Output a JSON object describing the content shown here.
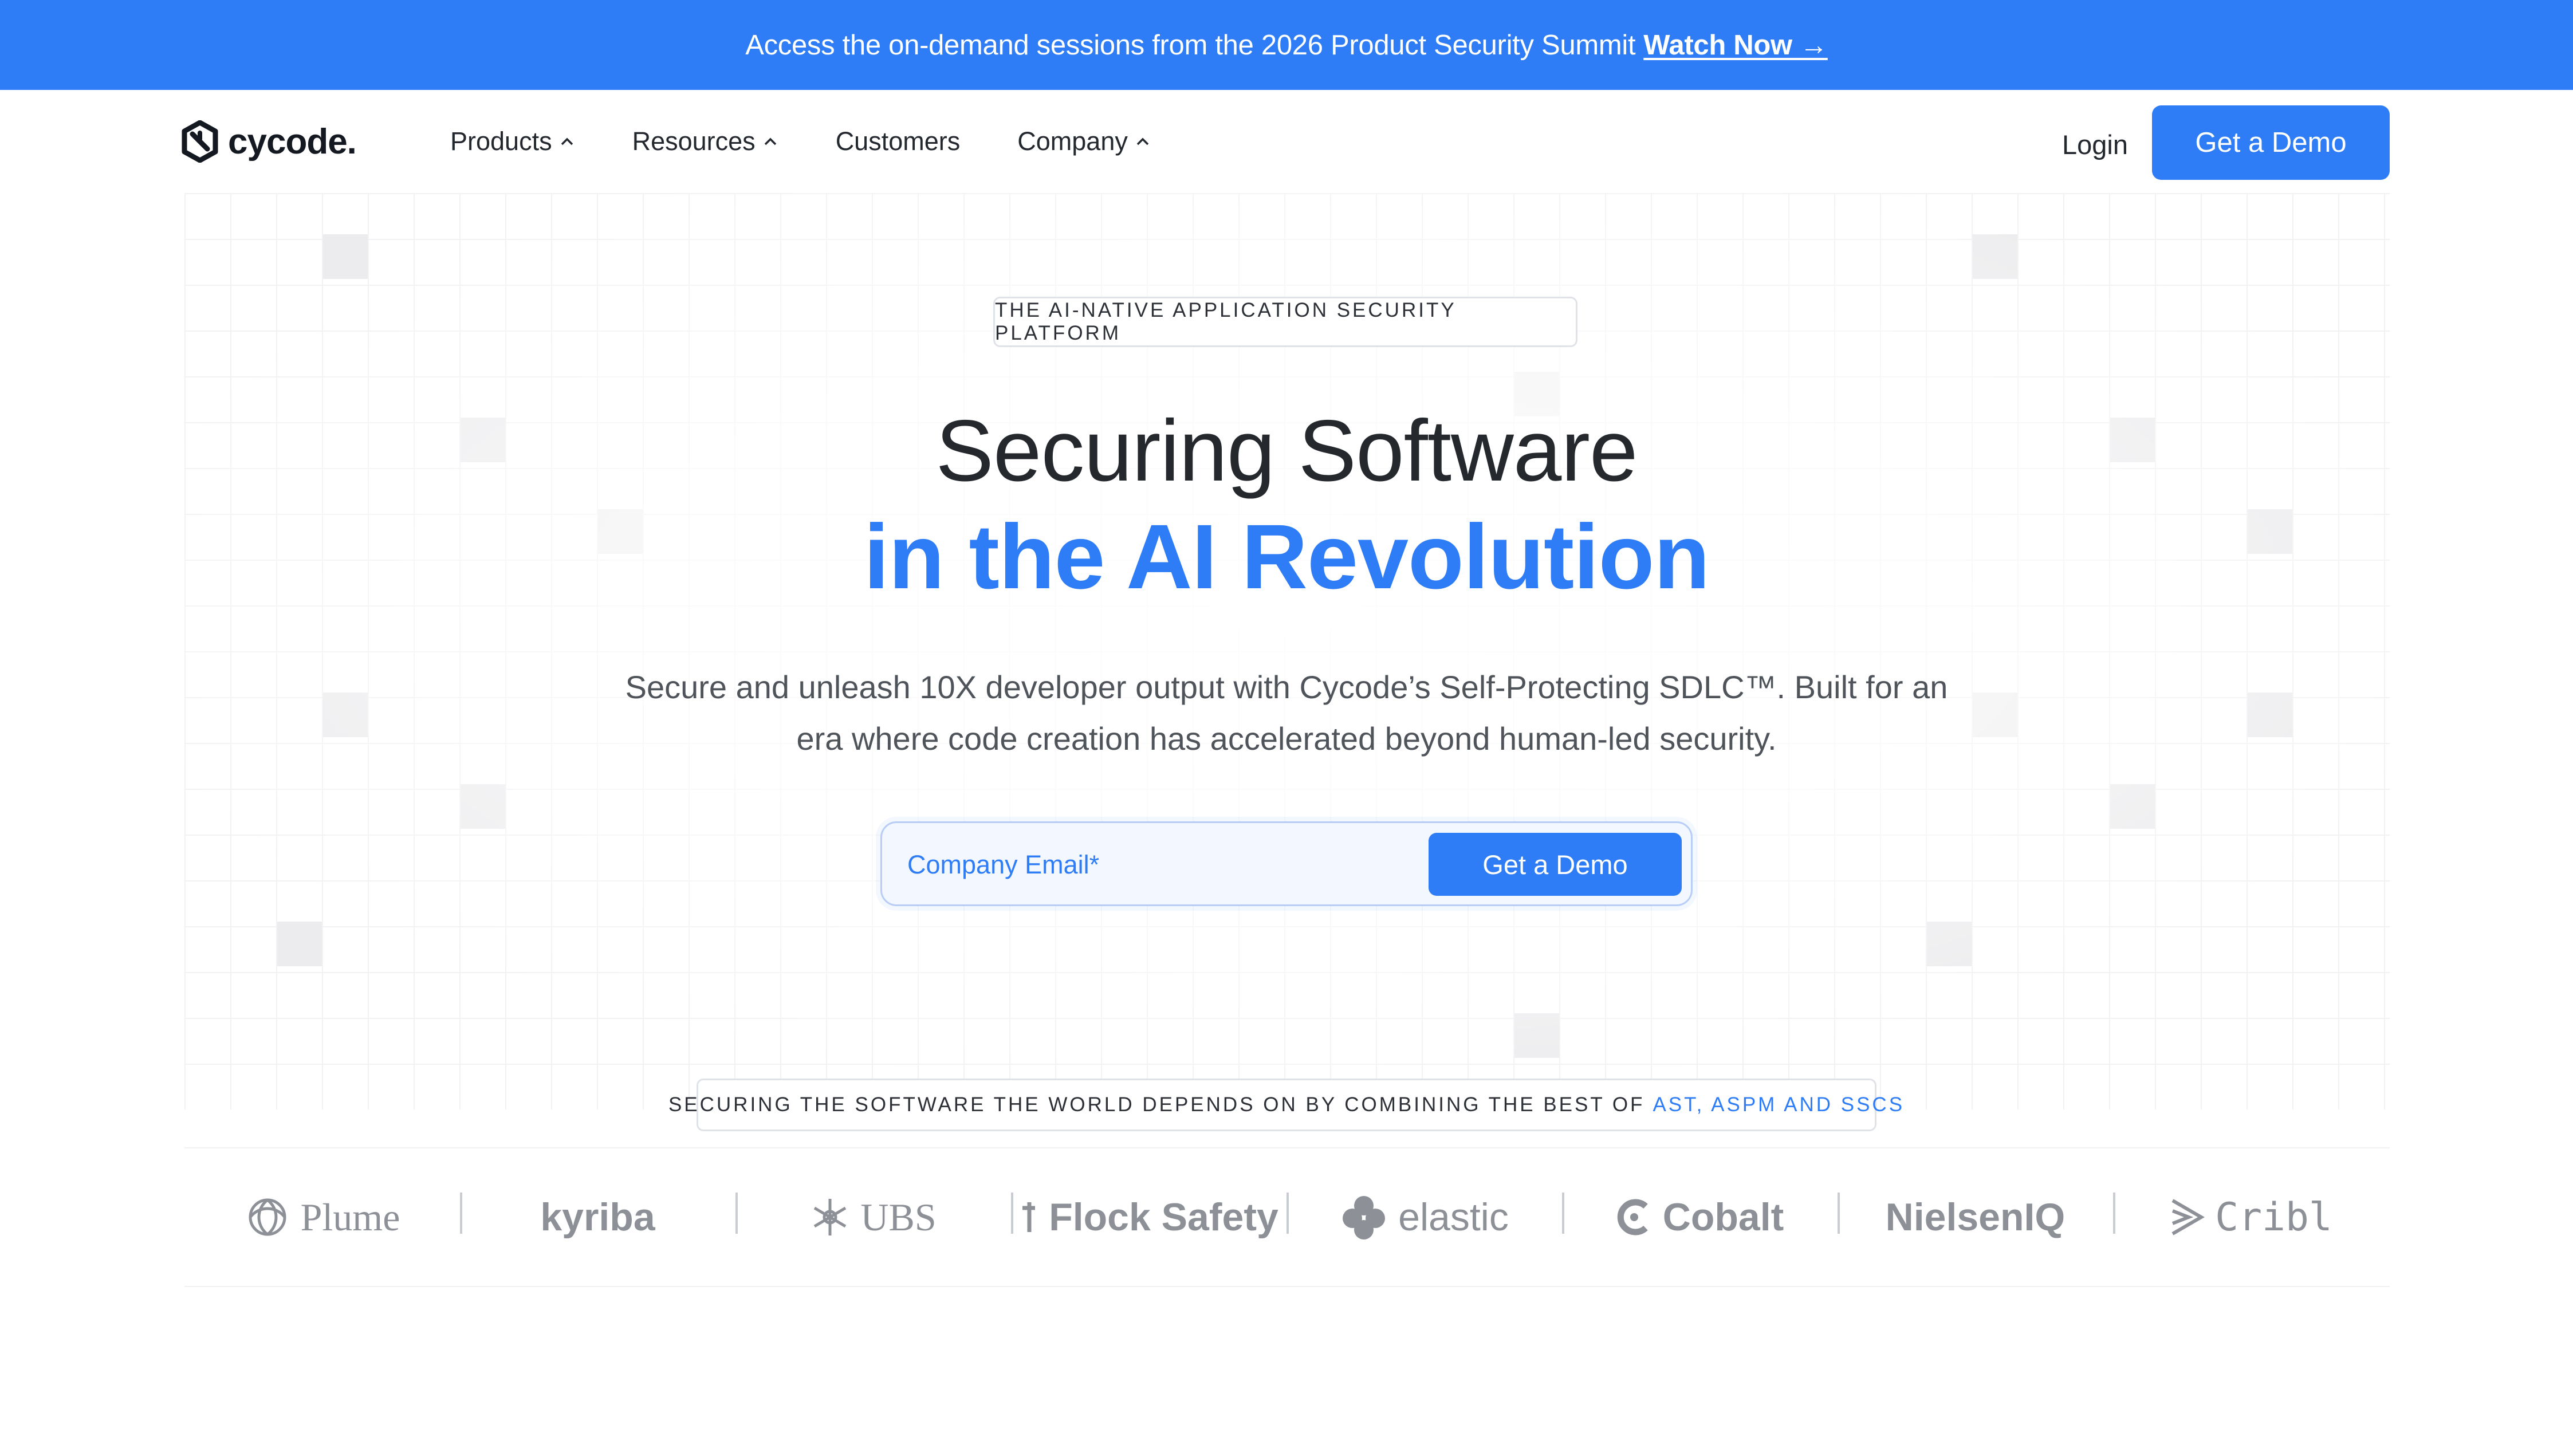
{
  "announcement": {
    "text": "Access the on-demand sessions from the 2026 Product Security Summit",
    "link_label": "Watch Now →"
  },
  "nav": {
    "logo_text": "cycode.",
    "items": [
      {
        "label": "Products",
        "has_dropdown": true
      },
      {
        "label": "Resources",
        "has_dropdown": true
      },
      {
        "label": "Customers",
        "has_dropdown": false
      },
      {
        "label": "Company",
        "has_dropdown": true
      }
    ],
    "login_label": "Login",
    "cta_label": "Get a Demo"
  },
  "hero": {
    "eyebrow": "THE AI-NATIVE APPLICATION SECURITY PLATFORM",
    "headline_line1": "Securing Software",
    "headline_line2": "in the AI Revolution",
    "subtext": "Secure and unleash 10X developer output with Cycode’s Self-Protecting SDLC™. Built for an era where code creation has accelerated beyond human-led security.",
    "email_placeholder": "Company Email*",
    "form_cta_label": "Get a Demo"
  },
  "trust": {
    "text": "SECURING THE SOFTWARE THE WORLD DEPENDS ON BY COMBINING THE BEST OF",
    "highlight": "AST, ASPM AND SSCS"
  },
  "customer_logos": [
    {
      "name": "Plume",
      "icon": "plume-swirl-icon"
    },
    {
      "name": "kyriba",
      "icon": "none"
    },
    {
      "name": "UBS",
      "icon": "ubs-keys-icon"
    },
    {
      "name": "Flock Safety",
      "icon": "flock-icon"
    },
    {
      "name": "elastic",
      "icon": "elastic-cluster-icon"
    },
    {
      "name": "Cobalt",
      "icon": "cobalt-c-icon"
    },
    {
      "name": "NielsenIQ",
      "icon": "none"
    },
    {
      "name": "Cribl",
      "icon": "cribl-lines-icon"
    }
  ],
  "colors": {
    "brand_blue": "#2e7df6",
    "text_dark": "#25282d",
    "logo_gray": "#8d9197"
  }
}
